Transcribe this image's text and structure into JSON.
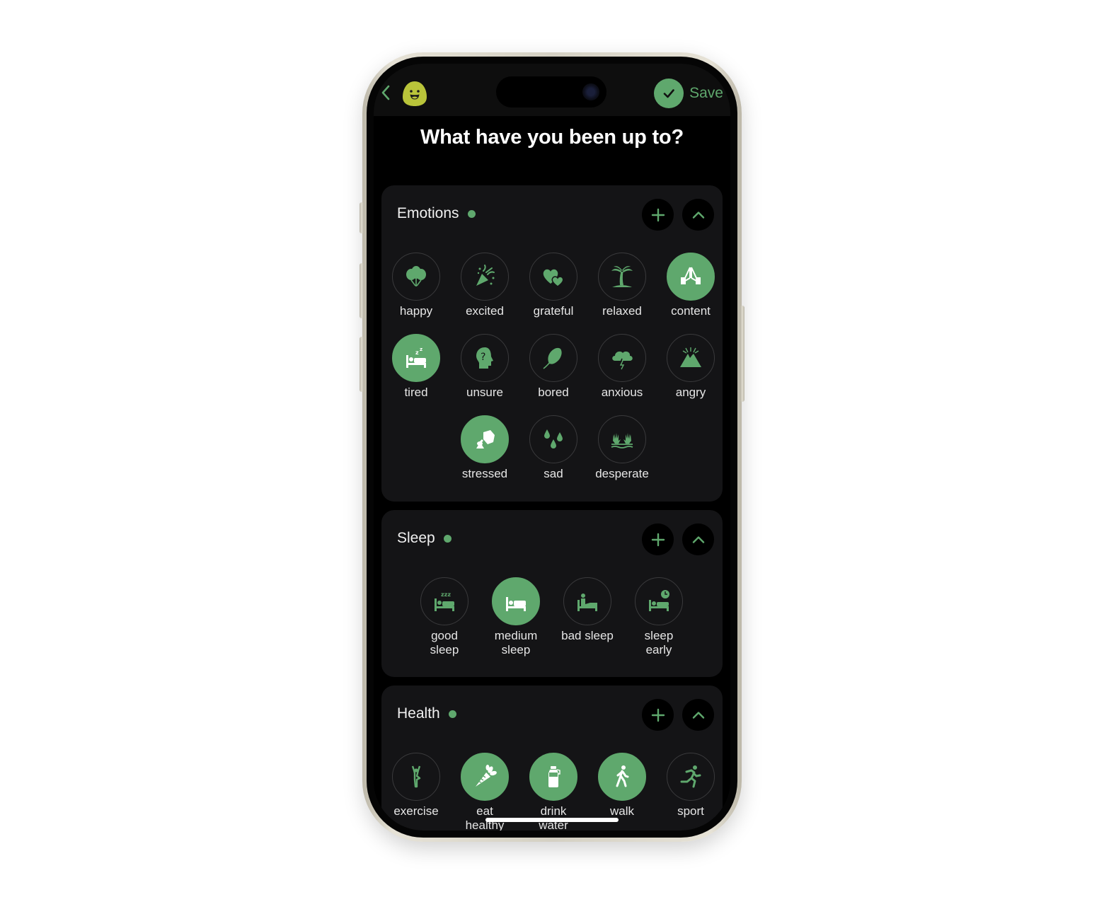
{
  "header": {
    "back_icon": "chevron-left-icon",
    "logo_icon": "smiling-blob-logo",
    "save_label": "Save",
    "save_icon": "checkmark-icon"
  },
  "page_title": "What have you been up to?",
  "colors": {
    "accent": "#5fa86d",
    "logo": "#b9c43a",
    "card_bg": "#141416",
    "screen_bg": "#000000"
  },
  "sections": [
    {
      "title": "Emotions",
      "add_icon": "plus-icon",
      "collapse_icon": "chevron-up-icon",
      "items": [
        {
          "label": "happy",
          "icon": "balloons-icon",
          "selected": false
        },
        {
          "label": "excited",
          "icon": "party-popper-icon",
          "selected": false
        },
        {
          "label": "grateful",
          "icon": "two-hearts-icon",
          "selected": false
        },
        {
          "label": "relaxed",
          "icon": "palm-tree-icon",
          "selected": false
        },
        {
          "label": "content",
          "icon": "praying-hands-icon",
          "selected": true
        },
        {
          "label": "tired",
          "icon": "bed-zzz-icon",
          "selected": true
        },
        {
          "label": "unsure",
          "icon": "head-question-icon",
          "selected": false
        },
        {
          "label": "bored",
          "icon": "leaf-icon",
          "selected": false
        },
        {
          "label": "anxious",
          "icon": "storm-cloud-icon",
          "selected": false
        },
        {
          "label": "angry",
          "icon": "volcano-icon",
          "selected": false
        },
        {
          "label": "stressed",
          "icon": "pressing-hand-icon",
          "selected": true
        },
        {
          "label": "sad",
          "icon": "tear-drops-icon",
          "selected": false
        },
        {
          "label": "desperate",
          "icon": "drowning-hands-icon",
          "selected": false
        }
      ]
    },
    {
      "title": "Sleep",
      "add_icon": "plus-icon",
      "collapse_icon": "chevron-up-icon",
      "items": [
        {
          "label": "good sleep",
          "icon": "bed-zzz-icon",
          "selected": false
        },
        {
          "label": "medium sleep",
          "icon": "bed-icon",
          "selected": true
        },
        {
          "label": "bad sleep",
          "icon": "bed-sitting-icon",
          "selected": false
        },
        {
          "label": "sleep early",
          "icon": "bed-clock-icon",
          "selected": false
        }
      ]
    },
    {
      "title": "Health",
      "add_icon": "plus-icon",
      "collapse_icon": "chevron-up-icon",
      "items": [
        {
          "label": "exercise",
          "icon": "yoga-pose-icon",
          "selected": false
        },
        {
          "label": "eat healthy",
          "icon": "carrot-icon",
          "selected": true
        },
        {
          "label": "drink water",
          "icon": "water-bottle-icon",
          "selected": true
        },
        {
          "label": "walk",
          "icon": "walking-person-icon",
          "selected": true
        },
        {
          "label": "sport",
          "icon": "running-person-icon",
          "selected": false
        }
      ]
    }
  ]
}
